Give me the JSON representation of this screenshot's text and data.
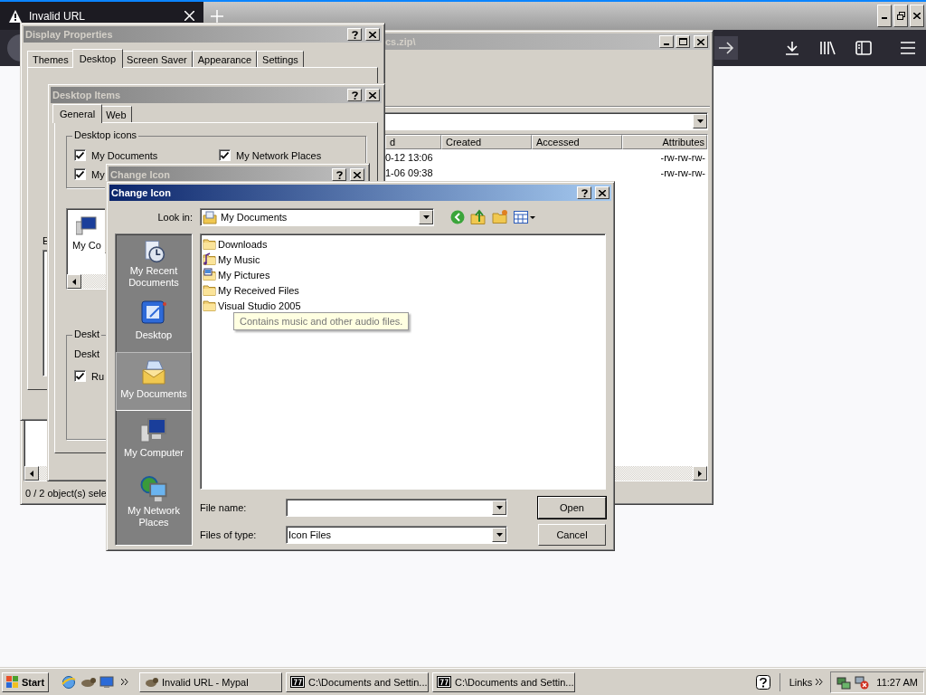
{
  "browser": {
    "tab": {
      "title": "Invalid URL"
    }
  },
  "archive_window": {
    "title": "cs.zip\\",
    "active": false,
    "columns": [
      "d",
      "Created",
      "Accessed",
      "Attributes"
    ],
    "rows": [
      [
        "0-12 13:06",
        "",
        "",
        "-rw-rw-rw-"
      ],
      [
        "1-06 09:38",
        "",
        "",
        "-rw-rw-rw-"
      ]
    ],
    "status": "0 / 2 object(s) sele"
  },
  "display_properties": {
    "title": "Display Properties",
    "active": false,
    "tabs": [
      {
        "label": "Themes",
        "selected": false
      },
      {
        "label": "Desktop",
        "selected": true
      },
      {
        "label": "Screen Saver",
        "selected": false
      },
      {
        "label": "Appearance",
        "selected": false
      },
      {
        "label": "Settings",
        "selected": false
      }
    ],
    "label": "E"
  },
  "desktop_items": {
    "title": "Desktop Items",
    "active": false,
    "tabs": [
      {
        "label": "General",
        "selected": true
      },
      {
        "label": "Web",
        "selected": false
      }
    ],
    "icons_group": {
      "title": "Desktop icons",
      "checkboxes": [
        {
          "label": "My Documents",
          "checked": true
        },
        {
          "label": "My Network Places",
          "checked": true
        },
        {
          "label": "My",
          "checked": true
        }
      ]
    },
    "icon_list": [
      {
        "label": "My Co"
      }
    ],
    "cleanup_group": {
      "title": "Deskt",
      "text": "Deskt",
      "checkbox": {
        "label": "Ru",
        "checked": true
      }
    }
  },
  "change_icon": {
    "title": "Change Icon",
    "active": false
  },
  "open_dialog": {
    "title": "Change Icon",
    "active": true,
    "look_in_label": "Look in:",
    "look_in": "My Documents",
    "places": [
      {
        "label": "My Recent Documents",
        "kind": "recent",
        "selected": false
      },
      {
        "label": "Desktop",
        "kind": "desktop",
        "selected": false
      },
      {
        "label": "My Documents",
        "kind": "documents",
        "selected": true
      },
      {
        "label": "My Computer",
        "kind": "computer",
        "selected": false
      },
      {
        "label": "My Network Places",
        "kind": "network",
        "selected": false
      }
    ],
    "files": [
      {
        "name": "Downloads",
        "kind": "folder"
      },
      {
        "name": "My Music",
        "kind": "music"
      },
      {
        "name": "My Pictures",
        "kind": "pictures"
      },
      {
        "name": "My Received Files",
        "kind": "folder"
      },
      {
        "name": "Visual Studio 2005",
        "kind": "folder"
      }
    ],
    "tooltip": "Contains music and other audio files.",
    "file_name_label": "File name:",
    "file_type_label": "Files of type:",
    "file_type": "Icon Files",
    "buttons": [
      "Open",
      "Cancel"
    ]
  },
  "taskbar": {
    "start": "Start",
    "tasks": [
      {
        "label": "Invalid URL - Mypal",
        "kind": "browser"
      },
      {
        "label": "C:\\Documents and Settin...",
        "kind": "archive"
      },
      {
        "label": "C:\\Documents and Settin...",
        "kind": "archive"
      }
    ],
    "links": "Links",
    "time": "11:27 AM"
  }
}
